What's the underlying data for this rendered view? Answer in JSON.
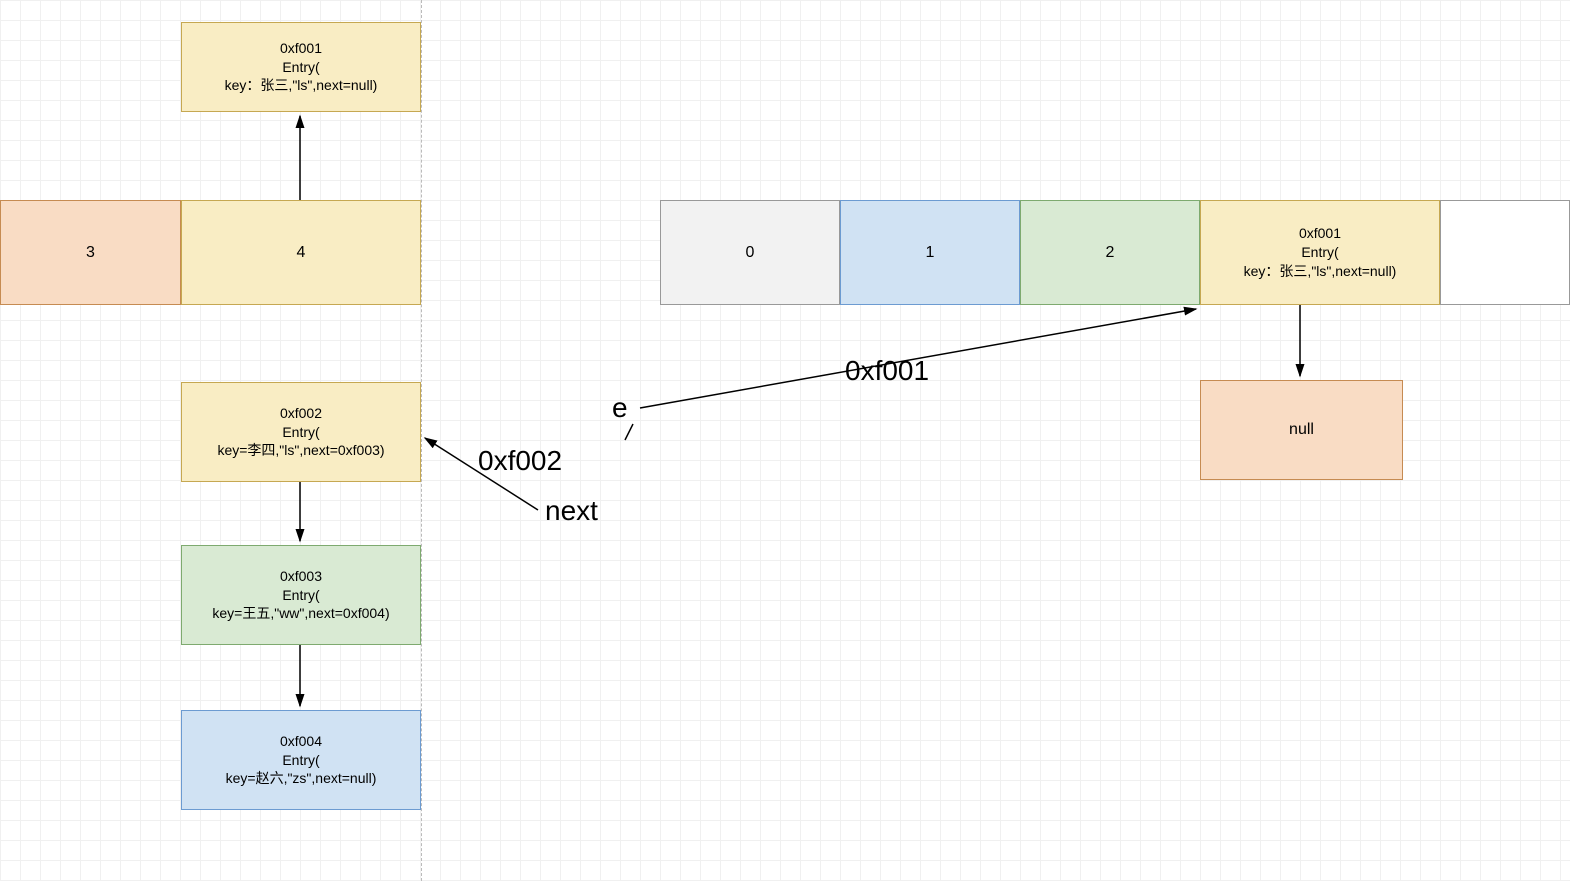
{
  "colors": {
    "orange": "#f9dcc4",
    "yellow": "#f9edc4",
    "green": "#d9ead3",
    "blue": "#d0e2f3",
    "grey": "#f2f2f2",
    "orangeBorder": "#c68b52",
    "yellowBorder": "#c6a852",
    "greenBorder": "#7eaa6f",
    "blueBorder": "#6c9bd1",
    "greyBorder": "#999"
  },
  "leftTable": {
    "cell3": "3",
    "cell4": "4"
  },
  "rightTable": {
    "cell0": "0",
    "cell1": "1",
    "cell2": "2",
    "cell3_line1": "0xf001",
    "cell3_line2": "Entry(",
    "cell3_line3": "key：张三,\"ls\",next=null)"
  },
  "entryTop": {
    "line1": "0xf001",
    "line2": "Entry(",
    "line3": "key：张三,\"ls\",next=null)"
  },
  "entryF002": {
    "line1": "0xf002",
    "line2": "Entry(",
    "line3": "key=李四,\"ls\",next=0xf003)"
  },
  "entryF003": {
    "line1": "0xf003",
    "line2": "Entry(",
    "line3": "key=王五,\"ww\",next=0xf004)"
  },
  "entryF004": {
    "line1": "0xf004",
    "line2": "Entry(",
    "line3": "key=赵六,\"zs\",next=null)"
  },
  "nullBox": "null",
  "labels": {
    "e": "e",
    "addr1": "0xf001",
    "addr2": "0xf002",
    "next": "next"
  }
}
